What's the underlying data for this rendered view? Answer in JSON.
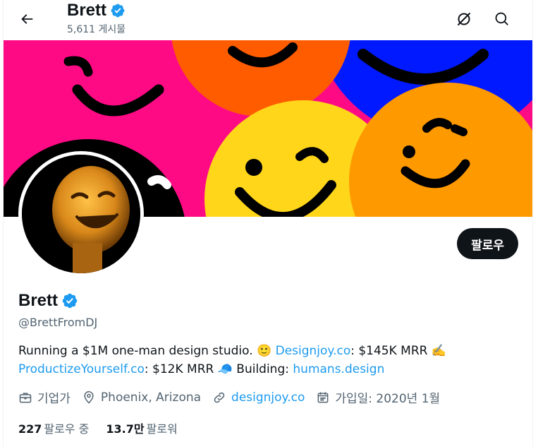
{
  "header": {
    "title": "Brett",
    "posts": "5,611 게시물"
  },
  "profile": {
    "name": "Brett",
    "handle": "@BrettFromDJ",
    "follow_label": "팔로우",
    "bio": {
      "line1_text1": "Running a $1M one-man design studio. 🙂 ",
      "line1_link": "Designjoy.co",
      "line1_text2": ": $145K MRR ✍️",
      "line2_link1": "ProductizeYourself.co",
      "line2_text1": ": $12K MRR 🧢 Building: ",
      "line2_link2": "humans.design"
    },
    "meta": {
      "category": "기업가",
      "location": "Phoenix, Arizona",
      "website": "designjoy.co",
      "joined": "가입일: 2020년 1월"
    },
    "stats": {
      "following_count": "227",
      "following_label": "팔로우 중",
      "followers_count": "13.7만",
      "followers_label": "팔로워"
    }
  },
  "colors": {
    "accent": "#1d9bf0",
    "text": "#0f1419",
    "muted": "#536471",
    "banner_pink": "#ff0a85",
    "banner_orange": "#ff5c00",
    "banner_blue": "#0019ff",
    "banner_yellow": "#ffd61a",
    "banner_amber": "#ff9900"
  },
  "icons": {
    "back": "arrow-left-icon",
    "grok": "grok-icon",
    "search": "search-icon",
    "verified": "verified-badge-icon",
    "briefcase": "briefcase-icon",
    "location": "location-pin-icon",
    "link": "link-icon",
    "calendar": "calendar-icon"
  }
}
